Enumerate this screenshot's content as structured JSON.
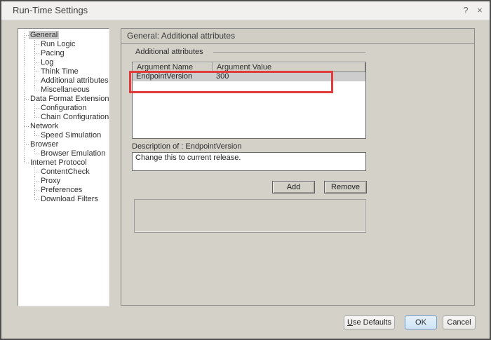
{
  "window": {
    "title": "Run-Time Settings",
    "help_icon": "?",
    "close_icon": "×"
  },
  "tree": {
    "items": [
      {
        "label": "General",
        "level": 0,
        "selected": true
      },
      {
        "label": "Run Logic",
        "level": 1
      },
      {
        "label": "Pacing",
        "level": 1
      },
      {
        "label": "Log",
        "level": 1
      },
      {
        "label": "Think Time",
        "level": 1
      },
      {
        "label": "Additional attributes",
        "level": 1
      },
      {
        "label": "Miscellaneous",
        "level": 1
      },
      {
        "label": "Data Format Extension",
        "level": 0
      },
      {
        "label": "Configuration",
        "level": 1
      },
      {
        "label": "Chain Configuration",
        "level": 1
      },
      {
        "label": "Network",
        "level": 0
      },
      {
        "label": "Speed Simulation",
        "level": 1
      },
      {
        "label": "Browser",
        "level": 0
      },
      {
        "label": "Browser Emulation",
        "level": 1
      },
      {
        "label": "Internet Protocol",
        "level": 0
      },
      {
        "label": "ContentCheck",
        "level": 1
      },
      {
        "label": "Proxy",
        "level": 1
      },
      {
        "label": "Preferences",
        "level": 1
      },
      {
        "label": "Download Filters",
        "level": 1
      }
    ]
  },
  "panel": {
    "header": "General: Additional attributes",
    "group_label": "Additional attributes",
    "table": {
      "columns": [
        "Argument Name",
        "Argument Value"
      ],
      "rows": [
        {
          "name": "EndpointVersion",
          "value": "300",
          "selected": true
        }
      ]
    },
    "description_label": "Description of : EndpointVersion",
    "description_text": "Change this to current release.",
    "add_label": "Add",
    "remove_label": "Remove"
  },
  "footer": {
    "use_defaults_underlined": "U",
    "use_defaults_rest": "se Defaults",
    "ok_label": "OK",
    "cancel_label": "Cancel"
  },
  "colors": {
    "annotation_red": "#e23b3b",
    "selected_row_gray": "#cdcdcd",
    "body_gray": "#d4d1c9",
    "ok_button_blue_border": "#6da1d4"
  }
}
